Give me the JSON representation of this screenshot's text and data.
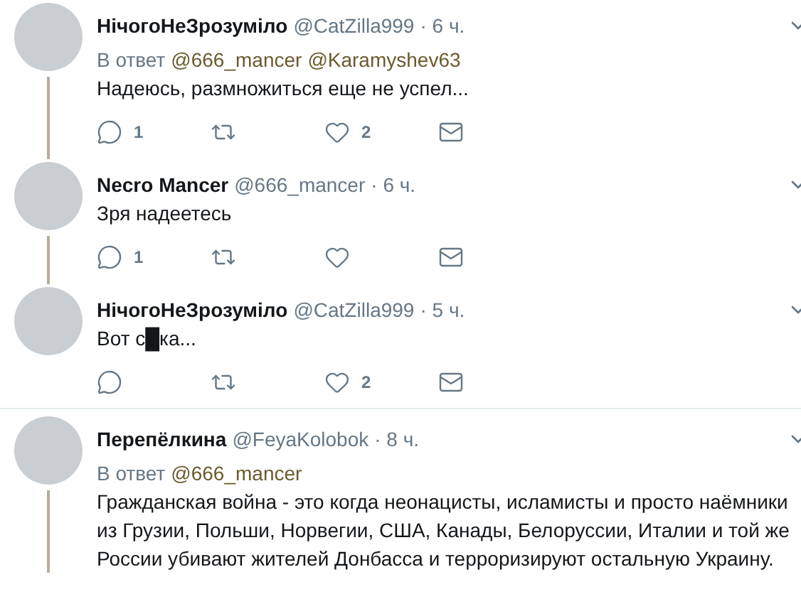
{
  "tweets": [
    {
      "name": "НічогоНеЗрозуміло",
      "handle": "@CatZilla999",
      "time": "· 6 ч.",
      "reply_to": {
        "label": "В ответ",
        "handles": [
          "@666_mancer",
          "@Karamyshev63"
        ]
      },
      "text": "Надеюсь, размножиться еще не успел...",
      "actions": {
        "replies": "1",
        "likes": "2"
      },
      "thread_below": true,
      "divider_below": false
    },
    {
      "name": "Necro Mancer",
      "handle": "@666_mancer",
      "time": "· 6 ч.",
      "text": "Зря надеетесь",
      "actions": {
        "replies": "1"
      },
      "thread_below": true,
      "divider_below": false
    },
    {
      "name": "НічогоНеЗрозуміло",
      "handle": "@CatZilla999",
      "time": "· 5 ч.",
      "text": "Вот с█ка...",
      "actions": {
        "likes": "2"
      },
      "thread_below": false,
      "divider_below": true
    },
    {
      "name": "Перепёлкина",
      "handle": "@FeyaKolobok",
      "time": "· 8 ч.",
      "reply_to": {
        "label": "В ответ",
        "handles": [
          "@666_mancer"
        ]
      },
      "text": "Гражданская война - это когда неонацисты, исламисты и просто наёмники из Грузии, Польши, Норвегии, США, Канады, Белоруссии, Италии и той же России убивают жителей Донбасса и терроризируют остальную Украину.",
      "thread_below": true,
      "divider_below": false
    }
  ]
}
